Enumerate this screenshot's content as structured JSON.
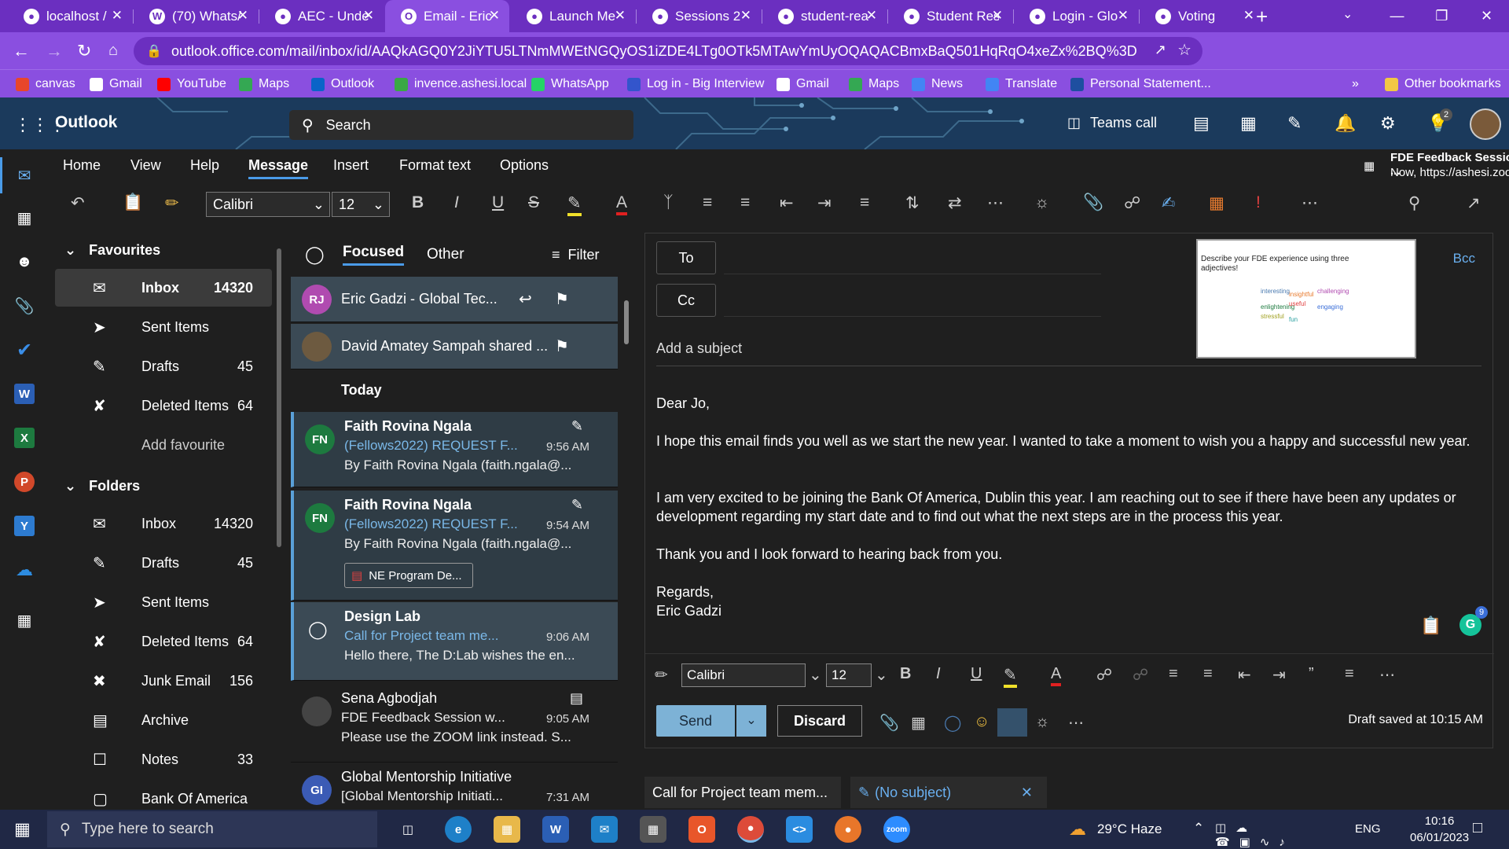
{
  "tabs": [
    {
      "title": "localhost /",
      "icon": "chart-icon",
      "active": false
    },
    {
      "title": "(70) Whats/",
      "icon": "whatsapp-icon",
      "active": false
    },
    {
      "title": "AEC - Unde",
      "icon": "globe-icon",
      "active": false
    },
    {
      "title": "Email - Eric",
      "icon": "outlook-icon",
      "active": true
    },
    {
      "title": "Launch Me",
      "icon": "globe-icon",
      "active": false
    },
    {
      "title": "Sessions 2",
      "icon": "bar-chart-icon",
      "active": false
    },
    {
      "title": "student-rea",
      "icon": "globe-icon",
      "active": false
    },
    {
      "title": "Student Res",
      "icon": "bar-chart-icon",
      "active": false
    },
    {
      "title": "Login - Glo",
      "icon": "bar-chart-icon",
      "active": false
    },
    {
      "title": "Voting",
      "icon": "voting-icon",
      "active": false
    }
  ],
  "address": {
    "url": "outlook.office.com/mail/inbox/id/AAQkAGQ0Y2JiYTU5LTNmMWEtNGQyOS1iZDE4LTg0OTk5MTAwYmUyOQAQACBmxBaQ501HqRqO4xeZx%2BQ%3D",
    "profile": "E"
  },
  "bookmarks": [
    {
      "label": "canvas",
      "color": "#e8462b"
    },
    {
      "label": "Gmail",
      "color": "#ffffff"
    },
    {
      "label": "YouTube",
      "color": "#ff0000"
    },
    {
      "label": "Maps",
      "color": "#34a853"
    },
    {
      "label": "Outlook",
      "color": "#0a64c8"
    },
    {
      "label": "invence.ashesi.local",
      "color": "#3aa845"
    },
    {
      "label": "WhatsApp",
      "color": "#25d366"
    },
    {
      "label": "Log in - Big Interview",
      "color": "#3355cc"
    },
    {
      "label": "Gmail",
      "color": "#ffffff"
    },
    {
      "label": "Maps",
      "color": "#34a853"
    },
    {
      "label": "News",
      "color": "#4285f4"
    },
    {
      "label": "Translate",
      "color": "#4285f4"
    },
    {
      "label": "Personal Statement...",
      "color": "#1e4fa0"
    },
    {
      "label": "»",
      "color": ""
    },
    {
      "label": "Other bookmarks",
      "color": "#f2c744"
    }
  ],
  "outlook": {
    "app_name": "Outlook",
    "search_placeholder": "Search",
    "teams_call": "Teams call",
    "badge_count": "2"
  },
  "ribbon": {
    "tabs": [
      "Home",
      "View",
      "Help",
      "Message",
      "Insert",
      "Format text",
      "Options"
    ],
    "active": "Message",
    "font": "Calibri",
    "size": "12"
  },
  "meeting": {
    "title": "FDE Feedback Session with ...",
    "detail": "Now, https://ashesi.zoom.us..."
  },
  "folders": {
    "favourites_label": "Favourites",
    "favourites": [
      {
        "label": "Inbox",
        "count": "14320",
        "icon": "inbox-icon"
      },
      {
        "label": "Sent Items",
        "count": "",
        "icon": "send-icon"
      },
      {
        "label": "Drafts",
        "count": "45",
        "icon": "pencil-icon"
      },
      {
        "label": "Deleted Items",
        "count": "64",
        "icon": "trash-icon"
      },
      {
        "label": "Add favourite",
        "count": "",
        "icon": ""
      }
    ],
    "folders_label": "Folders",
    "items": [
      {
        "label": "Inbox",
        "count": "14320",
        "icon": "inbox-icon"
      },
      {
        "label": "Drafts",
        "count": "45",
        "icon": "pencil-icon"
      },
      {
        "label": "Sent Items",
        "count": "",
        "icon": "send-icon"
      },
      {
        "label": "Deleted Items",
        "count": "64",
        "icon": "trash-icon"
      },
      {
        "label": "Junk Email",
        "count": "156",
        "icon": "junk-icon"
      },
      {
        "label": "Archive",
        "count": "",
        "icon": "archive-icon"
      },
      {
        "label": "Notes",
        "count": "33",
        "icon": "notes-icon"
      },
      {
        "label": "Bank Of America",
        "count": "",
        "icon": "folder-icon"
      }
    ]
  },
  "list": {
    "focused": "Focused",
    "other": "Other",
    "filter": "Filter",
    "today": "Today",
    "pinned": [
      {
        "initials": "RJ",
        "text": "Eric Gadzi - Global Tec...",
        "color": "#b04bb0"
      },
      {
        "initials": "",
        "text": "David Amatey Sampah shared ...",
        "color": "#6d5a40"
      }
    ],
    "messages": [
      {
        "initials": "FN",
        "color": "#1d7a3f",
        "sender": "Faith Rovina Ngala",
        "subject": "(Fellows2022) REQUEST F...",
        "time": "9:56 AM",
        "preview": "By Faith Rovina Ngala (faith.ngala@...",
        "attach": ""
      },
      {
        "initials": "FN",
        "color": "#1d7a3f",
        "sender": "Faith Rovina Ngala",
        "subject": "(Fellows2022) REQUEST F...",
        "time": "9:54 AM",
        "preview": "By Faith Rovina Ngala (faith.ngala@...",
        "attach": "NE Program De..."
      },
      {
        "initials": "",
        "color": "",
        "sender": "Design Lab",
        "subject": "Call for Project team me...",
        "time": "9:06 AM",
        "preview": "Hello there, The D:Lab wishes the en...",
        "attach": ""
      },
      {
        "initials": "",
        "color": "#444",
        "sender": "Sena Agbodjah",
        "subject": "FDE Feedback Session w...",
        "time": "9:05 AM",
        "preview": "Please use the ZOOM link instead. S...",
        "attach": ""
      },
      {
        "initials": "GI",
        "color": "#3b5bb5",
        "sender": "Global Mentorship Initiative",
        "subject": "[Global Mentorship Initiati...",
        "time": "7:31 AM",
        "preview": "",
        "attach": ""
      }
    ]
  },
  "compose": {
    "to_label": "To",
    "cc_label": "Cc",
    "bcc_label": "Bcc",
    "subject_placeholder": "Add a subject",
    "body": [
      "Dear Jo,",
      "I hope this email finds you well as we start the new year. I wanted to take a moment to wish you a happy and successful new year.",
      "I am very excited to be joining the Bank Of America, Dublin this year.  I am reaching out to see if there have been any updates or development regarding my start date and to find out what the next steps are in the process this year.",
      "Thank you and I look forward to hearing back from you.",
      "Regards,",
      "Eric Gadzi"
    ],
    "font": "Calibri",
    "size": "12",
    "send": "Send",
    "discard": "Discard",
    "draft_status": "Draft saved at 10:15 AM",
    "grammarly_count": "9"
  },
  "thumbnail": {
    "title": "Describe your FDE experience using three adjectives!",
    "words": [
      "interesting",
      "insightful",
      "challenging",
      "enlightening",
      "useful",
      "engaging",
      "stressful",
      "fun"
    ]
  },
  "bottom_tabs": [
    {
      "label": "Call for Project team mem..."
    },
    {
      "label": "(No subject)"
    }
  ],
  "taskbar": {
    "search_placeholder": "Type here to search",
    "weather": "29°C  Haze",
    "lang": "ENG",
    "time": "10:16",
    "date": "06/01/2023"
  }
}
